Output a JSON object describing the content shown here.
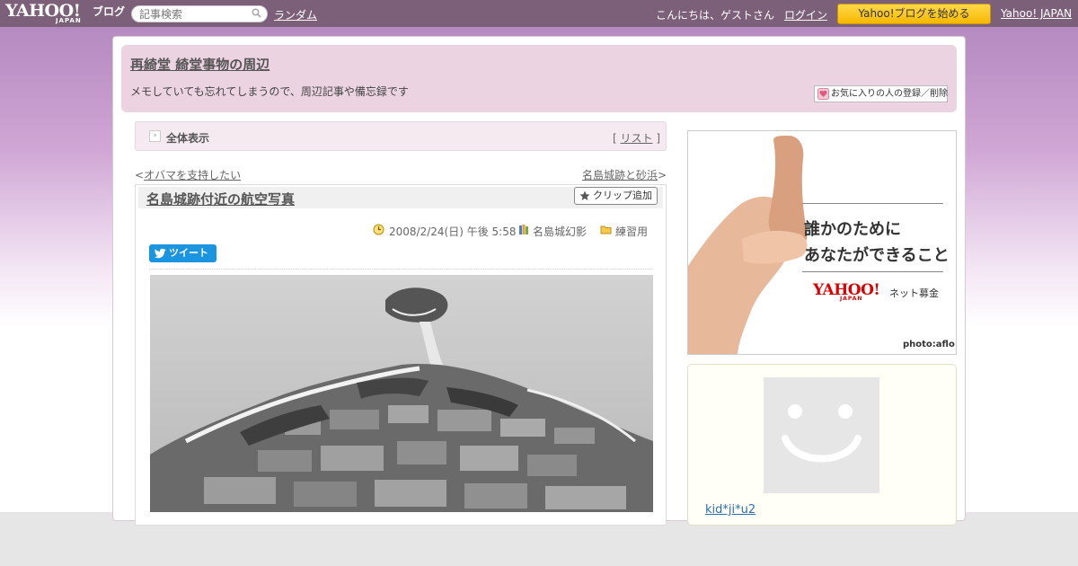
{
  "topbar": {
    "logo_yahoo": "YAHOO!",
    "logo_japan": "JAPAN",
    "logo_blog": "ブログ",
    "search_placeholder": "記事検索",
    "random_label": "ランダム",
    "greeting": "こんにちは、ゲストさん",
    "login_label": "ログイン",
    "start_blog_label": "Yahoo!ブログを始める",
    "yahoo_japan_label": "Yahoo! JAPAN"
  },
  "header": {
    "blog_title": "再綺堂 綺堂事物の周辺",
    "description": "メモしていても忘れてしまうので、周辺記事や備忘録です",
    "favorite_button": "お気に入りの人の登録／削除"
  },
  "viewbar": {
    "icon": "›",
    "label": "全体表示",
    "list_prefix": "[ ",
    "list_label": "リスト",
    "list_suffix": " ]"
  },
  "nav": {
    "prev_arrow": "<",
    "prev_label": "オバマを支持したい",
    "next_label": "名島城跡と砂浜",
    "next_arrow": ">"
  },
  "article": {
    "title": "名島城跡付近の航空写真",
    "clip_label": "クリップ追加",
    "datetime": "2008/2/24(日) 午後 5:58",
    "category": "名島城幻影",
    "folder": "練習用",
    "tweet_label": "ツイート"
  },
  "ad": {
    "line1": "誰かのために",
    "line2": "あなたができること",
    "brand_yahoo": "YAHOO!",
    "brand_japan": "JAPAN",
    "brand_service": "ネット募金",
    "credit": "photo:aflo"
  },
  "profile": {
    "username": "kid*ji*u2"
  },
  "colors": {
    "topbar": "#7c6079",
    "header_bg": "#ecd3e2",
    "accent_button": "#f5b800",
    "tweet_blue": "#1b95e0",
    "link_blue": "#2a6fb0"
  }
}
